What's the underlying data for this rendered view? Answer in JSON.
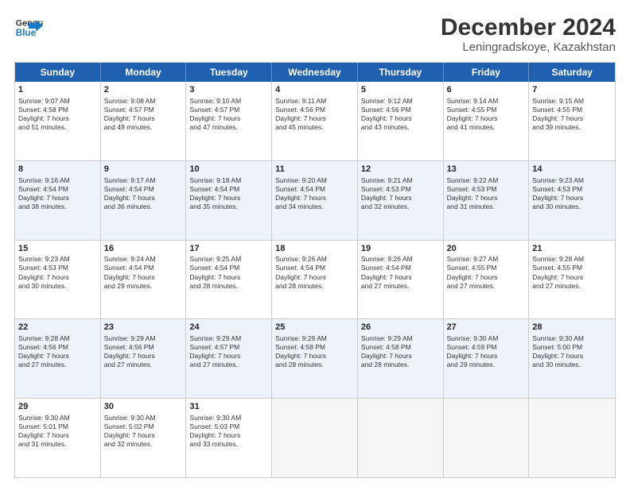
{
  "header": {
    "logo_line1": "General",
    "logo_line2": "Blue",
    "title": "December 2024",
    "subtitle": "Leningradskoye, Kazakhstan"
  },
  "weekdays": [
    "Sunday",
    "Monday",
    "Tuesday",
    "Wednesday",
    "Thursday",
    "Friday",
    "Saturday"
  ],
  "rows": [
    [
      {
        "num": "1",
        "info": "Sunrise: 9:07 AM\nSunset: 4:58 PM\nDaylight: 7 hours\nand 51 minutes."
      },
      {
        "num": "2",
        "info": "Sunrise: 9:08 AM\nSunset: 4:57 PM\nDaylight: 7 hours\nand 49 minutes."
      },
      {
        "num": "3",
        "info": "Sunrise: 9:10 AM\nSunset: 4:57 PM\nDaylight: 7 hours\nand 47 minutes."
      },
      {
        "num": "4",
        "info": "Sunrise: 9:11 AM\nSunset: 4:56 PM\nDaylight: 7 hours\nand 45 minutes."
      },
      {
        "num": "5",
        "info": "Sunrise: 9:12 AM\nSunset: 4:56 PM\nDaylight: 7 hours\nand 43 minutes."
      },
      {
        "num": "6",
        "info": "Sunrise: 9:14 AM\nSunset: 4:55 PM\nDaylight: 7 hours\nand 41 minutes."
      },
      {
        "num": "7",
        "info": "Sunrise: 9:15 AM\nSunset: 4:55 PM\nDaylight: 7 hours\nand 39 minutes."
      }
    ],
    [
      {
        "num": "8",
        "info": "Sunrise: 9:16 AM\nSunset: 4:54 PM\nDaylight: 7 hours\nand 38 minutes."
      },
      {
        "num": "9",
        "info": "Sunrise: 9:17 AM\nSunset: 4:54 PM\nDaylight: 7 hours\nand 36 minutes."
      },
      {
        "num": "10",
        "info": "Sunrise: 9:18 AM\nSunset: 4:54 PM\nDaylight: 7 hours\nand 35 minutes."
      },
      {
        "num": "11",
        "info": "Sunrise: 9:20 AM\nSunset: 4:54 PM\nDaylight: 7 hours\nand 34 minutes."
      },
      {
        "num": "12",
        "info": "Sunrise: 9:21 AM\nSunset: 4:53 PM\nDaylight: 7 hours\nand 32 minutes."
      },
      {
        "num": "13",
        "info": "Sunrise: 9:22 AM\nSunset: 4:53 PM\nDaylight: 7 hours\nand 31 minutes."
      },
      {
        "num": "14",
        "info": "Sunrise: 9:23 AM\nSunset: 4:53 PM\nDaylight: 7 hours\nand 30 minutes."
      }
    ],
    [
      {
        "num": "15",
        "info": "Sunrise: 9:23 AM\nSunset: 4:53 PM\nDaylight: 7 hours\nand 30 minutes."
      },
      {
        "num": "16",
        "info": "Sunrise: 9:24 AM\nSunset: 4:54 PM\nDaylight: 7 hours\nand 29 minutes."
      },
      {
        "num": "17",
        "info": "Sunrise: 9:25 AM\nSunset: 4:54 PM\nDaylight: 7 hours\nand 28 minutes."
      },
      {
        "num": "18",
        "info": "Sunrise: 9:26 AM\nSunset: 4:54 PM\nDaylight: 7 hours\nand 28 minutes."
      },
      {
        "num": "19",
        "info": "Sunrise: 9:26 AM\nSunset: 4:54 PM\nDaylight: 7 hours\nand 27 minutes."
      },
      {
        "num": "20",
        "info": "Sunrise: 9:27 AM\nSunset: 4:55 PM\nDaylight: 7 hours\nand 27 minutes."
      },
      {
        "num": "21",
        "info": "Sunrise: 9:28 AM\nSunset: 4:55 PM\nDaylight: 7 hours\nand 27 minutes."
      }
    ],
    [
      {
        "num": "22",
        "info": "Sunrise: 9:28 AM\nSunset: 4:56 PM\nDaylight: 7 hours\nand 27 minutes."
      },
      {
        "num": "23",
        "info": "Sunrise: 9:29 AM\nSunset: 4:56 PM\nDaylight: 7 hours\nand 27 minutes."
      },
      {
        "num": "24",
        "info": "Sunrise: 9:29 AM\nSunset: 4:57 PM\nDaylight: 7 hours\nand 27 minutes."
      },
      {
        "num": "25",
        "info": "Sunrise: 9:29 AM\nSunset: 4:58 PM\nDaylight: 7 hours\nand 28 minutes."
      },
      {
        "num": "26",
        "info": "Sunrise: 9:29 AM\nSunset: 4:58 PM\nDaylight: 7 hours\nand 28 minutes."
      },
      {
        "num": "27",
        "info": "Sunrise: 9:30 AM\nSunset: 4:59 PM\nDaylight: 7 hours\nand 29 minutes."
      },
      {
        "num": "28",
        "info": "Sunrise: 9:30 AM\nSunset: 5:00 PM\nDaylight: 7 hours\nand 30 minutes."
      }
    ],
    [
      {
        "num": "29",
        "info": "Sunrise: 9:30 AM\nSunset: 5:01 PM\nDaylight: 7 hours\nand 31 minutes."
      },
      {
        "num": "30",
        "info": "Sunrise: 9:30 AM\nSunset: 5:02 PM\nDaylight: 7 hours\nand 32 minutes."
      },
      {
        "num": "31",
        "info": "Sunrise: 9:30 AM\nSunset: 5:03 PM\nDaylight: 7 hours\nand 33 minutes."
      },
      {
        "num": "",
        "info": ""
      },
      {
        "num": "",
        "info": ""
      },
      {
        "num": "",
        "info": ""
      },
      {
        "num": "",
        "info": ""
      }
    ]
  ],
  "row_alt": [
    false,
    true,
    false,
    true,
    false
  ]
}
